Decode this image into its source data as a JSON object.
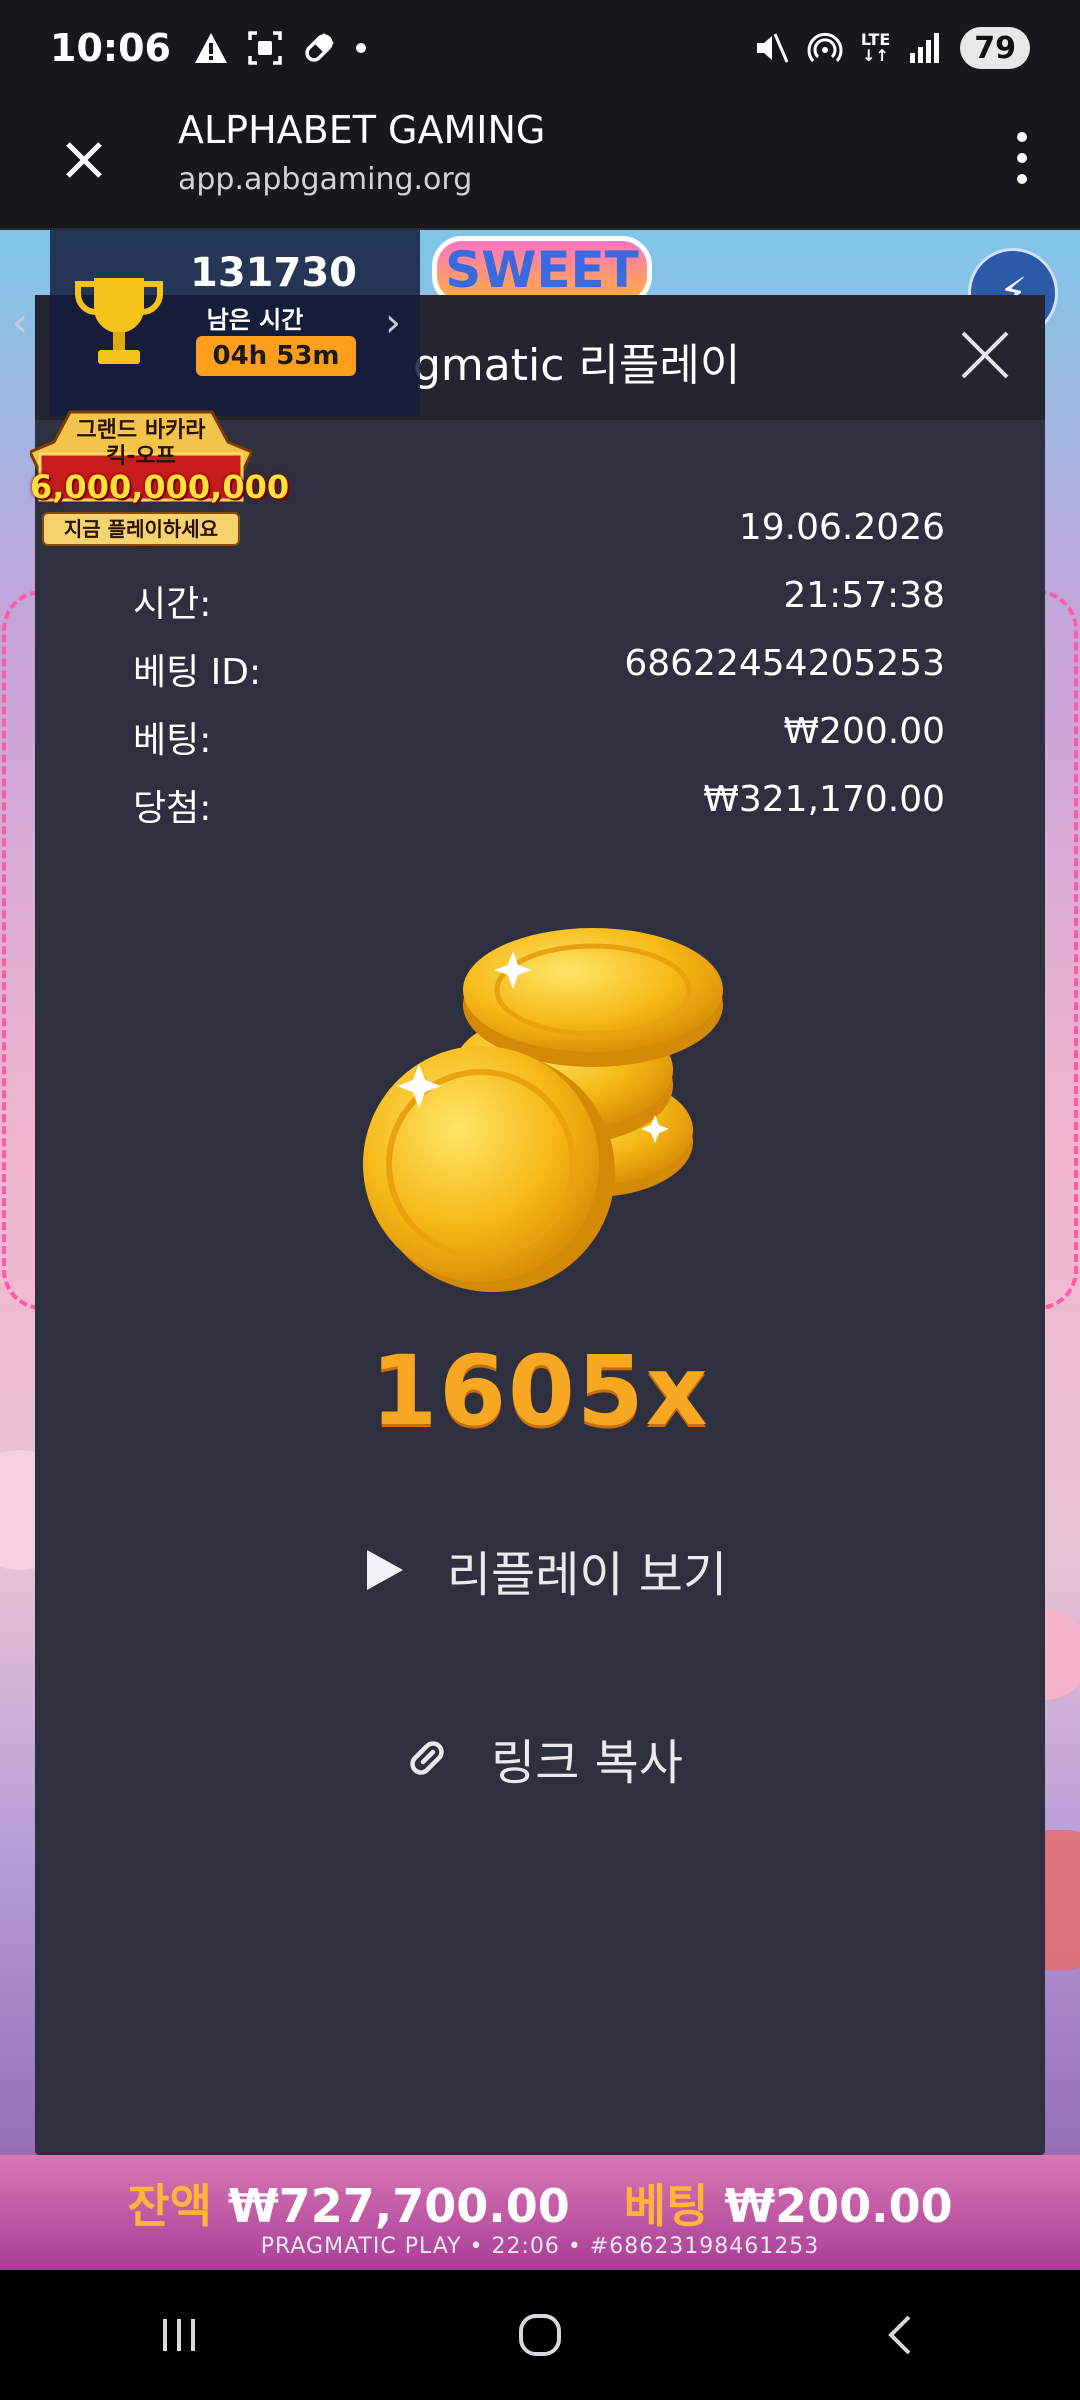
{
  "status_bar": {
    "time": "10:06",
    "lte_label": "LTE",
    "battery": "79",
    "icons_left": [
      "alert-icon",
      "screenshot-icon",
      "pill-icon",
      "dot-icon"
    ],
    "icons_right": [
      "mute-icon",
      "hotspot-icon",
      "lte-icon",
      "signal-icon",
      "battery-icon"
    ]
  },
  "browser": {
    "title": "ALPHABET GAMING",
    "url": "app.apbgaming.org"
  },
  "game": {
    "logo_text": "SWEET",
    "balance_label": "잔액",
    "balance_value": "₩727,700.00",
    "bet_label": "베팅",
    "bet_value": "₩200.00",
    "footer_meta": "PRAGMATIC PLAY • 22:06 • #68623198461253"
  },
  "tournament": {
    "score": "131730",
    "remaining_label": "남은 시간",
    "timer": "04h 53m",
    "badge_line1": "그랜드 바카라",
    "badge_line2": "킥-오프",
    "badge_amount": "6,000,000,000원",
    "badge_cta": "지금 플레이하세요"
  },
  "modal": {
    "title": "gmatic 리플레이",
    "rows": [
      {
        "key": "",
        "value": "19.06.2026"
      },
      {
        "key": "시간:",
        "value": "21:57:38"
      },
      {
        "key": "베팅 ID:",
        "value": "68622454205253"
      },
      {
        "key": "베팅:",
        "value": "₩200.00"
      },
      {
        "key": "당첨:",
        "value": "₩321,170.00"
      }
    ],
    "multiplier": "1605x",
    "watch_replay": "리플레이 보기",
    "copy_link": "링크 복사"
  },
  "colors": {
    "modal_bg": "#2e2f3f",
    "modal_header_bg": "#24252f",
    "multiplier": "#f7a721",
    "timer_bg": "#ff9d1c",
    "balance_label": "#ffb43b"
  }
}
